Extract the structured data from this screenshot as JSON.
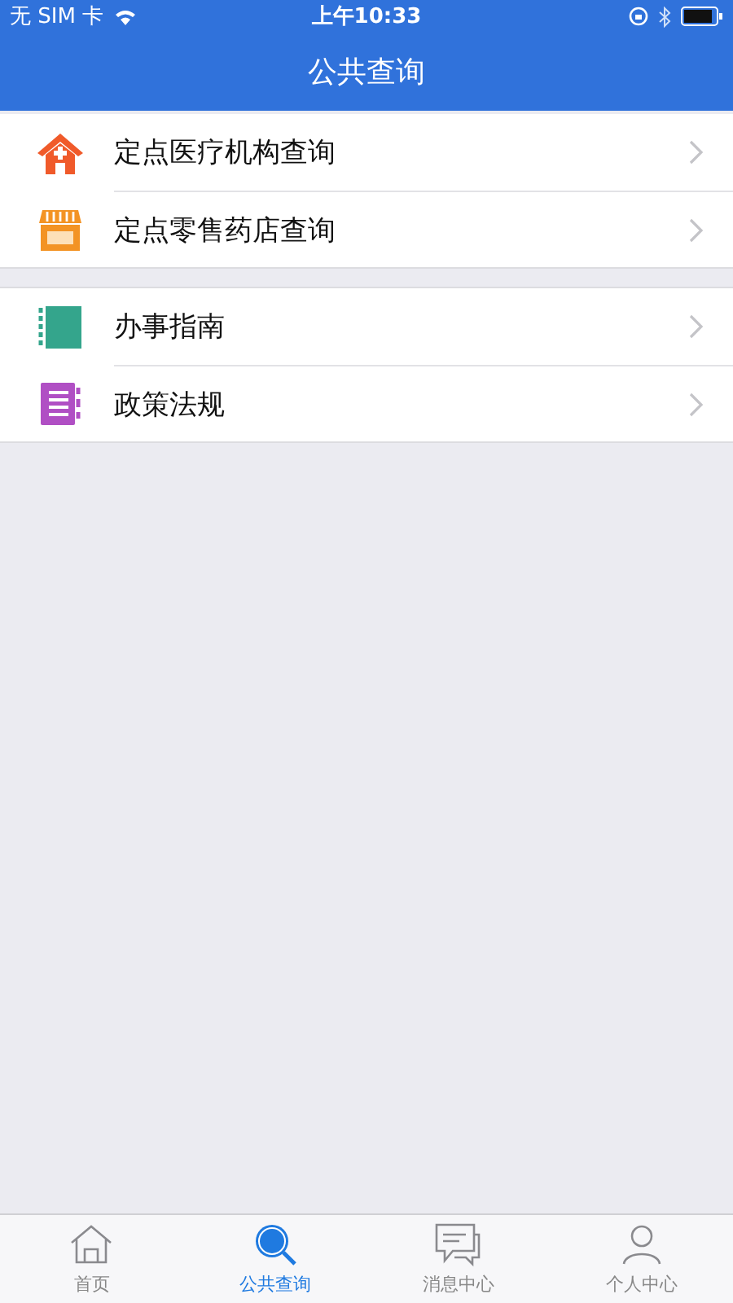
{
  "status_bar": {
    "carrier": "无 SIM 卡",
    "time": "上午10:33"
  },
  "nav_bar": {
    "title": "公共查询"
  },
  "groups": [
    {
      "items": [
        {
          "label": "定点医疗机构查询"
        },
        {
          "label": "定点零售药店查询"
        }
      ]
    },
    {
      "items": [
        {
          "label": "办事指南"
        },
        {
          "label": "政策法规"
        }
      ]
    }
  ],
  "tab_bar": [
    {
      "label": "首页",
      "selected": false
    },
    {
      "label": "公共查询",
      "selected": true
    },
    {
      "label": "消息中心",
      "selected": false
    },
    {
      "label": "个人中心",
      "selected": false
    }
  ]
}
